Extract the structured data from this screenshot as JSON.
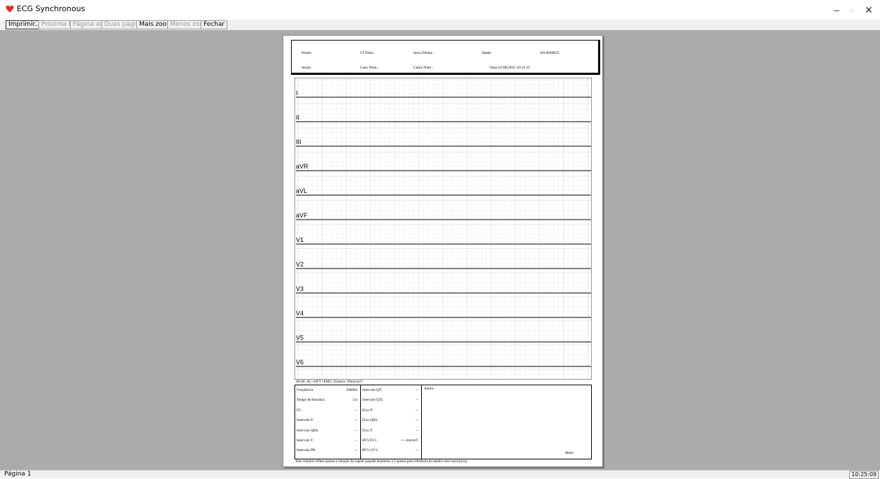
{
  "window": {
    "title": "ECG Synchronous",
    "minimize": "–",
    "maximize": "▫",
    "close": "✕"
  },
  "toolbar": {
    "print": "Imprimir...",
    "next_page": "Próxima Págin",
    "prev_page": "Página ant.",
    "two_pages": "Duas páginas",
    "zoom_in": "Mais zoom",
    "zoom_out": "Menos zoom",
    "close": "Fechar"
  },
  "report_header": {
    "name_label": "Nome:",
    "id_label": "CI Núm.:",
    "sex_label": "Sexo:Fêmea",
    "age_label": "Idade:",
    "serial": "SN:0000635",
    "section_label": "Seção:",
    "case_label": "Caso Núm.:",
    "bed_label": "Cama Núm.:",
    "date_label": "Data:25/08/2025 10:21:32"
  },
  "leads": [
    "I",
    "II",
    "III",
    "aVR",
    "aVL",
    "aVF",
    "V1",
    "V2",
    "V3",
    "V4",
    "V5",
    "V6"
  ],
  "ecg_settings": "00:00:   AC+DFT+EMG   25mm/s  10mm/mV",
  "measurements_left": [
    {
      "label": "Frequência:",
      "value": "1000Hz"
    },
    {
      "label": "Tempo de Amostra:",
      "value": "15s"
    },
    {
      "label": "FC:",
      "value": "--"
    },
    {
      "label": "Intervalo P:",
      "value": "--"
    },
    {
      "label": "Intervalo QRS:",
      "value": "--"
    },
    {
      "label": "Intervalo T:",
      "value": "--"
    },
    {
      "label": "Intervalo PR:",
      "value": "--"
    }
  ],
  "measurements_right": [
    {
      "label": "Intervalo QT:",
      "value": "--"
    },
    {
      "label": "Intervalo QTc:",
      "value": "--"
    },
    {
      "label": "Eixo P:",
      "value": "--"
    },
    {
      "label": "Eixo QRS:",
      "value": "--"
    },
    {
      "label": "Eixo T:",
      "value": "--"
    },
    {
      "label": "RV5/SV1:",
      "value": "--/--mm/mV"
    },
    {
      "label": "RV5+SV1:",
      "value": "--"
    }
  ],
  "alert_label": "Alerta:",
  "doctor_label": "Médi:",
  "footer_note": "Este relatório reflete apenas a situação do sujeito naquele momento, e é apenas para referência do médico sem outra prova.",
  "status": {
    "page": "Página 1",
    "time": "10:25:09"
  },
  "colors": {
    "workspace": "#ababab",
    "heart": "#e0302a"
  }
}
